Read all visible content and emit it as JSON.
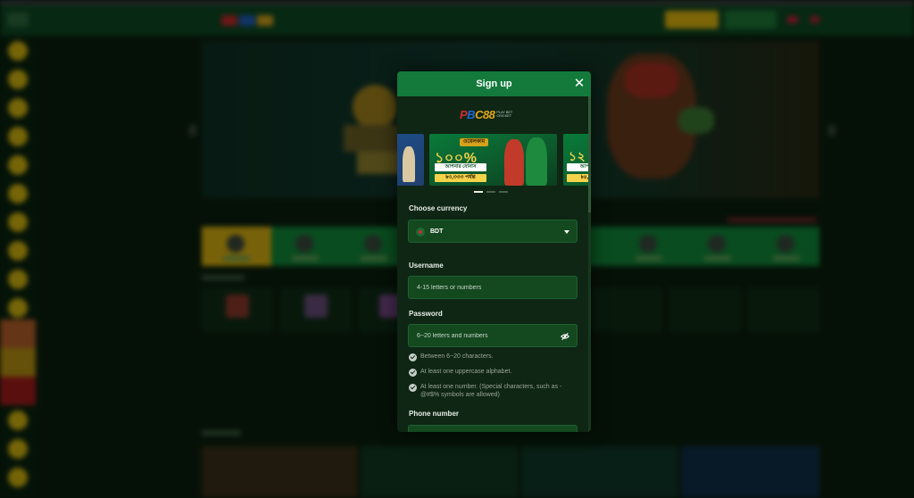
{
  "modal": {
    "title": "Sign up",
    "close_glyph": "✕",
    "brand": {
      "logo_letters": [
        "P",
        "B",
        "C88"
      ],
      "logo_tagline": "PLAY BET CRICKET"
    },
    "carousel": {
      "main_slide": {
        "tag": "ওয়েলকাম",
        "headline": "১০০%",
        "subline": "আপনার বোনাস",
        "amount": "৳৩,৩৩৩ পর্যন্ত"
      },
      "next_slide": {
        "headline": "১২",
        "subline": "আপ",
        "amount": "৳৪,"
      },
      "dots": 3,
      "active_dot": 0
    },
    "currency": {
      "label": "Choose currency",
      "value": "BDT",
      "flag_icon": "bangladesh-flag-icon"
    },
    "username": {
      "label": "Username",
      "placeholder": "4-15 letters or numbers"
    },
    "password": {
      "label": "Password",
      "placeholder": "6~20 letters and numbers",
      "toggle_icon": "eye-off-icon"
    },
    "password_rules": [
      "Between 6~20 characters.",
      "At least one uppercase alphabet.",
      "At least one number. (Special characters, such as - @#$% symbols are allowed)"
    ],
    "phone": {
      "label": "Phone number"
    }
  },
  "colors": {
    "modal_header": "#137a3c",
    "modal_bg": "#0f2614",
    "field_bg": "#14481f",
    "accent_gold": "#dbb311",
    "category_bar": "#128a3a"
  }
}
